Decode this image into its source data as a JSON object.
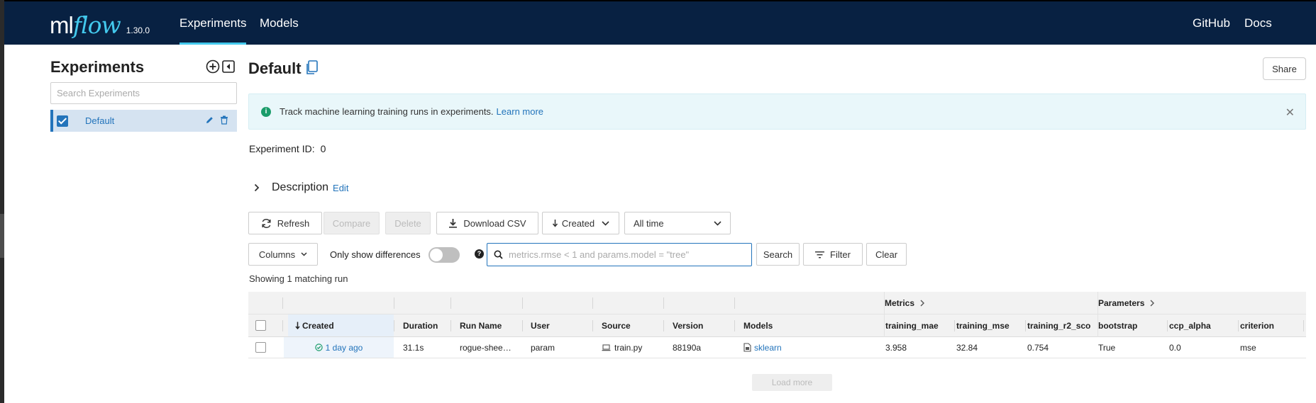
{
  "header": {
    "logo_ml": "ml",
    "logo_flow": "flow",
    "version": "1.30.0",
    "nav": {
      "experiments": "Experiments",
      "models": "Models",
      "github": "GitHub",
      "docs": "Docs"
    }
  },
  "sidebar": {
    "title": "Experiments",
    "search_placeholder": "Search Experiments",
    "items": [
      {
        "label": "Default",
        "checked": true
      }
    ]
  },
  "main": {
    "title": "Default",
    "share_label": "Share",
    "banner": {
      "text": "Track machine learning training runs in experiments.",
      "link": "Learn more"
    },
    "experiment_id_label": "Experiment ID:",
    "experiment_id_value": "0",
    "description_label": "Description",
    "description_edit": "Edit",
    "toolbar": {
      "refresh": "Refresh",
      "compare": "Compare",
      "delete": "Delete",
      "download_csv": "Download CSV",
      "sort": "Created",
      "time_range": "All time",
      "columns": "Columns",
      "only_show_differences": "Only show differences",
      "search_placeholder": "metrics.rmse < 1 and params.model = \"tree\"",
      "search": "Search",
      "filter": "Filter",
      "clear": "Clear"
    },
    "showing": "Showing 1 matching run",
    "table": {
      "groups": {
        "metrics": "Metrics",
        "parameters": "Parameters"
      },
      "columns": {
        "created": "Created",
        "duration": "Duration",
        "run_name": "Run Name",
        "user": "User",
        "source": "Source",
        "version": "Version",
        "models": "Models",
        "training_mae": "training_mae",
        "training_mse": "training_mse",
        "training_r2": "training_r2_sco",
        "bootstrap": "bootstrap",
        "ccp_alpha": "ccp_alpha",
        "criterion": "criterion"
      },
      "rows": [
        {
          "created": "1 day ago",
          "duration": "31.1s",
          "run_name": "rogue-shee…",
          "user": "param",
          "source": "train.py",
          "version": "88190a",
          "models": "sklearn",
          "training_mae": "3.958",
          "training_mse": "32.84",
          "training_r2": "0.754",
          "bootstrap": "True",
          "ccp_alpha": "0.0",
          "criterion": "mse"
        }
      ]
    },
    "load_more": "Load more"
  },
  "colors": {
    "header_bg": "#082142",
    "accent": "#43c9ed",
    "link": "#2374bb"
  }
}
